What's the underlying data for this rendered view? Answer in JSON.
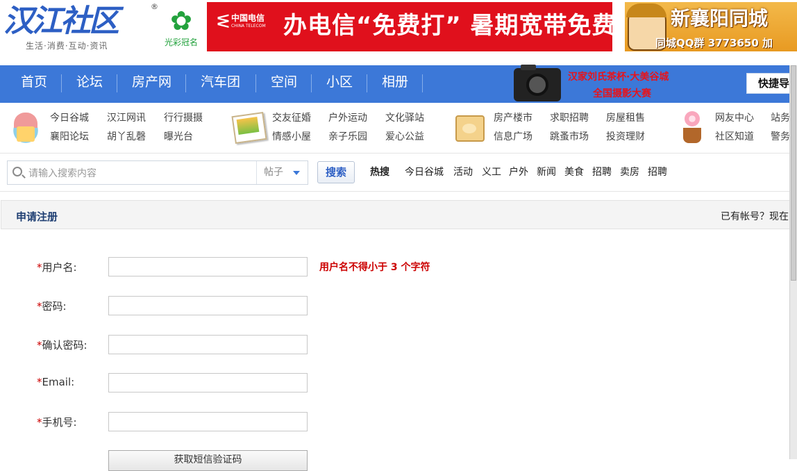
{
  "header": {
    "logo_main": "汉江社区",
    "logo_reg": "®",
    "logo_sub": "生活·消费·互动·资讯",
    "guangcai_icon": "flower-icon",
    "guangcai_text": "光彩冠名",
    "telecom_logo_cn": "中国电信",
    "telecom_logo_en": "CHINA TELECOM",
    "telecom_text": "办电信“免费打” 暑期宽带免费用",
    "xy_title": "新襄阳同城",
    "xy_qq": "同城QQ群 3773650 加"
  },
  "nav": {
    "items": [
      "首页",
      "论坛",
      "房产网",
      "汽车团",
      "空间",
      "小区",
      "相册"
    ],
    "ad_line1": "汉家刘氏茶杯·大美谷城",
    "ad_line2": "全国摄影大赛",
    "shortcut_label": "快捷导"
  },
  "quick": {
    "groups": [
      {
        "icon": "house-icon",
        "row1": [
          "今日谷城",
          "汉江网讯",
          "行行摄摄"
        ],
        "row2": [
          "襄阳论坛",
          "胡丫乱磬",
          "曝光台"
        ]
      },
      {
        "icon": "photo-icon",
        "row1": [
          "交友征婚",
          "户外运动",
          "文化驿站"
        ],
        "row2": [
          "情感小屋",
          "亲子乐园",
          "爱心公益"
        ]
      },
      {
        "icon": "box-icon",
        "row1": [
          "房产楼市",
          "求职招聘",
          "房屋租售"
        ],
        "row2": [
          "信息广场",
          "跳蚤市场",
          "投资理财"
        ]
      },
      {
        "icon": "flower-icon",
        "row1": [
          "网友中心",
          "站务"
        ],
        "row2": [
          "社区知道",
          "警务"
        ]
      }
    ]
  },
  "search": {
    "placeholder": "请输入搜索内容",
    "type": "帖子",
    "button": "搜索",
    "hot_label": "热搜",
    "hot_links": [
      "今日谷城",
      "活动",
      "义工",
      "户外",
      "新闻",
      "美食",
      "招聘",
      "卖房",
      "招聘"
    ]
  },
  "register": {
    "title": "申请注册",
    "have_account": "已有帐号？现在",
    "fields": [
      {
        "label": "用户名:"
      },
      {
        "label": "密码:"
      },
      {
        "label": "确认密码:"
      },
      {
        "label": "Email:"
      },
      {
        "label": "手机号:"
      }
    ],
    "required_mark": "*",
    "username_hint": "用户名不得小于  3 个字符",
    "sms_button": "获取短信验证码"
  }
}
